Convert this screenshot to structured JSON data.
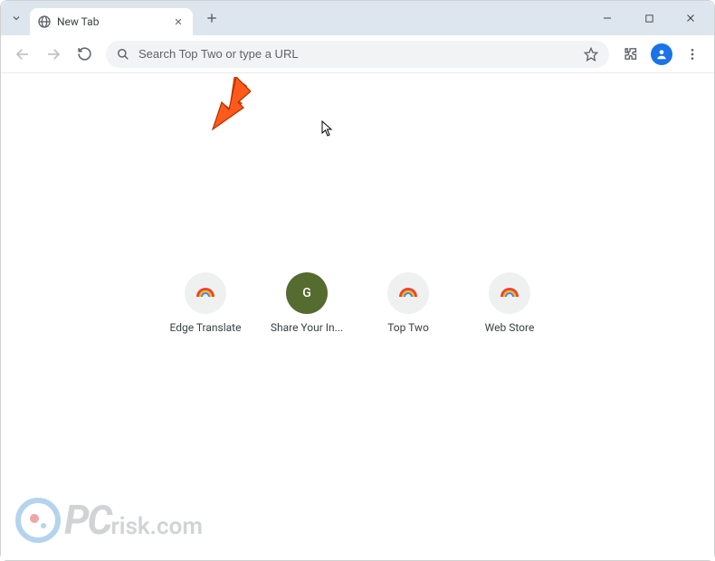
{
  "tab": {
    "title": "New Tab"
  },
  "omnibox": {
    "placeholder": "Search Top Two or type a URL"
  },
  "shortcuts": [
    {
      "label": "Edge Translate",
      "icon": "rainbow"
    },
    {
      "label": "Share Your In...",
      "icon": "letter",
      "letter": "G"
    },
    {
      "label": "Top Two",
      "icon": "rainbow"
    },
    {
      "label": "Web Store",
      "icon": "rainbow"
    }
  ],
  "watermark": {
    "first": "PC",
    "rest": "risk.com"
  }
}
